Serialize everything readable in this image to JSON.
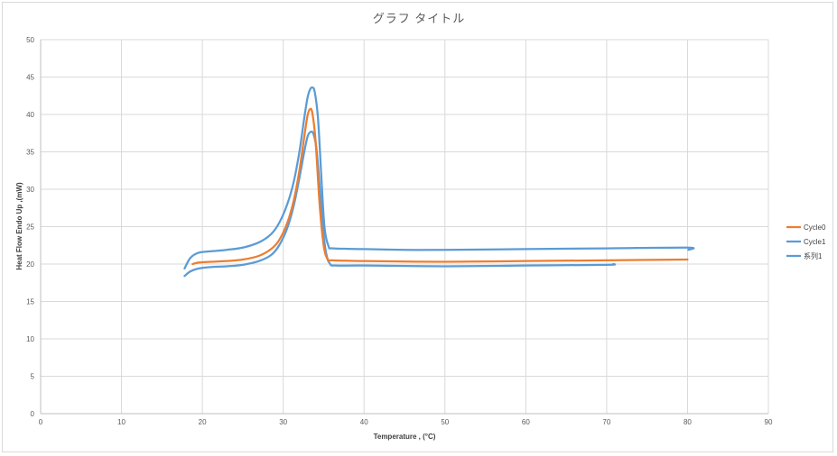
{
  "chart_data": {
    "type": "line",
    "title": "グラフ タイトル",
    "xlabel": "Temperature , (°C)",
    "ylabel": "Heat Flow Endo Up ,(mW)",
    "xlim": [
      0,
      90
    ],
    "ylim": [
      0,
      50
    ],
    "xticks": [
      "0",
      "10",
      "20",
      "30",
      "40",
      "50",
      "60",
      "70",
      "80",
      "90"
    ],
    "yticks": [
      "0",
      "5",
      "10",
      "15",
      "20",
      "25",
      "30",
      "35",
      "40",
      "45",
      "50"
    ],
    "grid": true,
    "legend_position": "right",
    "series": [
      {
        "name": "Cycle0",
        "color": "#ED7D31",
        "x": [
          18.8,
          19.5,
          21,
          23,
          25,
          27,
          28.5,
          29.5,
          30.5,
          31.3,
          32,
          32.6,
          33,
          33.3,
          33.6,
          34,
          34.5,
          35,
          35.5,
          36,
          40,
          50,
          60,
          70,
          80
        ],
        "y": [
          20.0,
          20.2,
          20.3,
          20.4,
          20.6,
          21.1,
          22.0,
          23.2,
          25.5,
          28.5,
          32.5,
          37.0,
          39.8,
          40.7,
          40.2,
          36.5,
          28.0,
          22.5,
          20.6,
          20.5,
          20.4,
          20.3,
          20.4,
          20.5,
          20.6
        ]
      },
      {
        "name": "Cycle1",
        "color": "#5B9BD5",
        "x": [
          17.8,
          18.5,
          19.5,
          21,
          23,
          25,
          27,
          28.5,
          29.5,
          30.5,
          31.3,
          32,
          32.6,
          33,
          33.3,
          33.6,
          33.9,
          34.3,
          34.7,
          35.1,
          35.6,
          36.2,
          40,
          45,
          50,
          60,
          70,
          80,
          80.1
        ],
        "y": [
          19.4,
          20.8,
          21.5,
          21.7,
          21.9,
          22.2,
          22.9,
          24.0,
          25.5,
          28.0,
          31.0,
          35.0,
          39.5,
          42.2,
          43.3,
          43.6,
          43.0,
          39.5,
          32.0,
          25.0,
          22.4,
          22.1,
          22.0,
          21.9,
          21.9,
          22.0,
          22.1,
          22.2,
          21.9
        ]
      },
      {
        "name": "系列1",
        "color": "#5B9BD5",
        "x": [
          17.8,
          18.5,
          19.5,
          21,
          23,
          25,
          27,
          28.5,
          29.5,
          30.5,
          31.3,
          32,
          32.6,
          33,
          33.3,
          33.7,
          34.1,
          34.5,
          34.9,
          35.3,
          35.8,
          36.5,
          40,
          50,
          60,
          70,
          70.8
        ],
        "y": [
          18.4,
          19.0,
          19.4,
          19.6,
          19.7,
          19.9,
          20.4,
          21.2,
          22.5,
          24.8,
          27.8,
          31.5,
          35.0,
          37.0,
          37.6,
          37.5,
          35.5,
          30.5,
          25.0,
          21.5,
          20.0,
          19.8,
          19.8,
          19.7,
          19.8,
          19.9,
          20.0
        ]
      }
    ]
  }
}
